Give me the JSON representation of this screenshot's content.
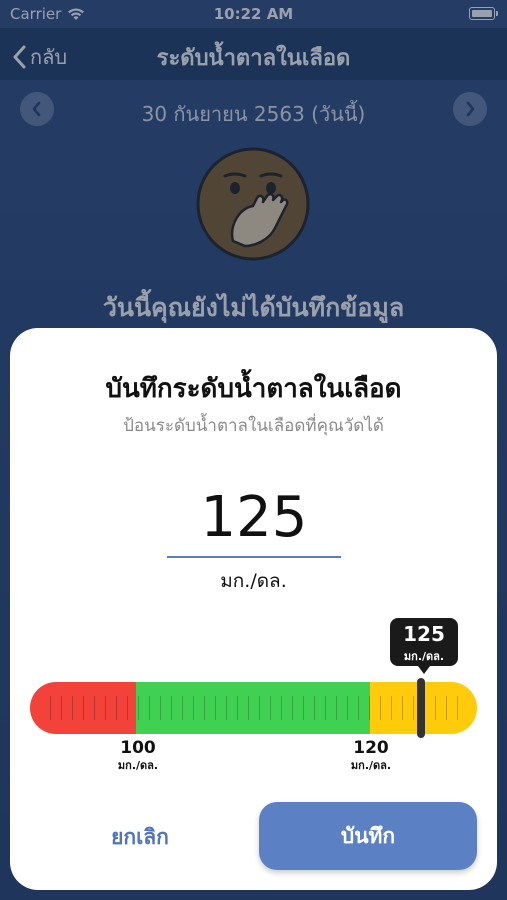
{
  "status_bar": {
    "carrier": "Carrier",
    "time": "10:22 AM"
  },
  "nav": {
    "back_label": "กลับ",
    "title": "ระดับน้ำตาลในเลือด"
  },
  "date": {
    "text": "30 กันยายน 2563 (วันนี้)"
  },
  "empty_state": {
    "message": "วันนี้คุณยังไม่ได้บันทึกข้อมูล"
  },
  "sheet": {
    "title": "บันทึกระดับน้ำตาลในเลือด",
    "subtitle": "ป้อนระดับน้ำตาลในเลือดที่คุณวัดได้",
    "input_value": "125",
    "unit": "มก./ดล."
  },
  "gauge": {
    "current_value": "125",
    "current_unit": "มก./ดล.",
    "thresholds": [
      {
        "value": "100",
        "unit": "มก./ดล."
      },
      {
        "value": "120",
        "unit": "มก./ดล."
      }
    ],
    "zone_colors": {
      "low": "#f2423a",
      "normal": "#41d152",
      "high": "#ffcb0a"
    }
  },
  "buttons": {
    "cancel": "ยกเลิก",
    "save": "บันทึก"
  },
  "colors": {
    "accent": "#5b80c4",
    "nav_bg": "#1b3966"
  },
  "icons": [
    "wifi-icon",
    "battery-icon",
    "chevron-left-icon",
    "chevron-right-icon",
    "emoji-hand-over-mouth-icon"
  ]
}
